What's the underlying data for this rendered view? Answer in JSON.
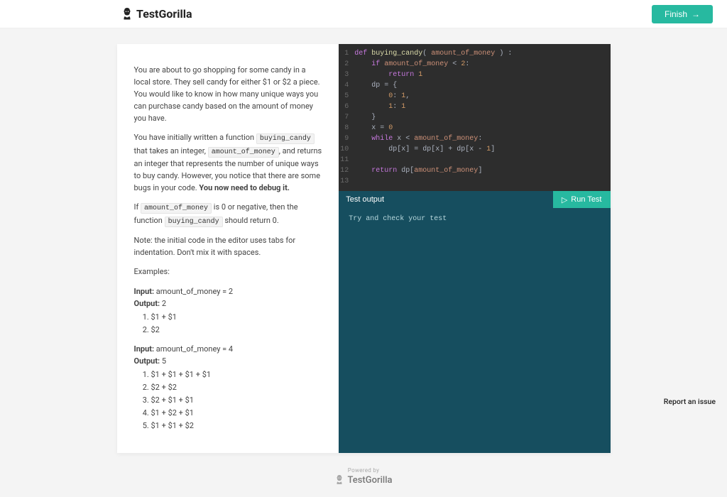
{
  "header": {
    "logo_text": "TestGorilla",
    "finish_label": "Finish"
  },
  "problem": {
    "intro": "You are about to go shopping for some candy in a local store. They sell candy for either $1 or $2 a piece. You would like to know in how many unique ways you can purchase candy based on the amount of money you have.",
    "para2_a": "You have initially written a function ",
    "code_fn": "buying_candy",
    "para2_b": " that takes an integer, ",
    "code_param": "amount_of_money",
    "para2_c": ", and returns an integer that represents the number of unique ways to buy candy. However, you notice that there are some bugs in your code. ",
    "bold_debug": "You now need to debug it.",
    "para3_a": "If ",
    "para3_b": " is 0 or negative, then the function ",
    "para3_c": " should return 0.",
    "note": "Note: the initial code in the editor uses tabs for indentation. Don't mix it with spaces.",
    "examples_label": "Examples:",
    "ex1_input_label": "Input:",
    "ex1_input_val": " amount_of_money = 2",
    "ex1_output_label": "Output:",
    "ex1_output_val": " 2",
    "ex1_items": [
      "$1 + $1",
      "$2"
    ],
    "ex2_input_label": "Input:",
    "ex2_input_val": " amount_of_money = 4",
    "ex2_output_label": "Output:",
    "ex2_output_val": " 5",
    "ex2_items": [
      "$1 + $1 + $1 + $1",
      "$2 + $2",
      "$2 + $1 + $1",
      "$1 + $2 + $1",
      "$1 + $1 + $2"
    ]
  },
  "editor": {
    "lines": [
      {
        "n": "1",
        "tokens": [
          [
            "kw",
            "def "
          ],
          [
            "id",
            "buying_candy"
          ],
          [
            "op",
            "( "
          ],
          [
            "param",
            "amount_of_money"
          ],
          [
            "op",
            " ) :"
          ]
        ]
      },
      {
        "n": "2",
        "tokens": [
          [
            "op",
            "    "
          ],
          [
            "kw",
            "if "
          ],
          [
            "param",
            "amount_of_money"
          ],
          [
            "op",
            " < "
          ],
          [
            "num",
            "2"
          ],
          [
            "op",
            ":"
          ]
        ]
      },
      {
        "n": "3",
        "tokens": [
          [
            "op",
            "        "
          ],
          [
            "kw",
            "return "
          ],
          [
            "num",
            "1"
          ]
        ]
      },
      {
        "n": "4",
        "tokens": [
          [
            "op",
            "    dp = {"
          ]
        ]
      },
      {
        "n": "5",
        "tokens": [
          [
            "op",
            "        "
          ],
          [
            "num",
            "0"
          ],
          [
            "op",
            ": "
          ],
          [
            "num",
            "1"
          ],
          [
            "op",
            ","
          ]
        ]
      },
      {
        "n": "6",
        "tokens": [
          [
            "op",
            "        "
          ],
          [
            "num",
            "1"
          ],
          [
            "op",
            ": "
          ],
          [
            "num",
            "1"
          ]
        ]
      },
      {
        "n": "7",
        "tokens": [
          [
            "op",
            "    }"
          ]
        ]
      },
      {
        "n": "8",
        "tokens": [
          [
            "op",
            "    x = "
          ],
          [
            "num",
            "0"
          ]
        ]
      },
      {
        "n": "9",
        "tokens": [
          [
            "op",
            "    "
          ],
          [
            "kw",
            "while "
          ],
          [
            "op",
            "x < "
          ],
          [
            "param",
            "amount_of_money"
          ],
          [
            "op",
            ":"
          ]
        ]
      },
      {
        "n": "10",
        "tokens": [
          [
            "op",
            "        dp[x] = dp[x] + dp[x - "
          ],
          [
            "num",
            "1"
          ],
          [
            "op",
            "]"
          ]
        ]
      },
      {
        "n": "11",
        "tokens": [
          [
            "op",
            ""
          ]
        ]
      },
      {
        "n": "12",
        "tokens": [
          [
            "op",
            "    "
          ],
          [
            "kw",
            "return "
          ],
          [
            "op",
            "dp["
          ],
          [
            "param",
            "amount_of_money"
          ],
          [
            "op",
            "]"
          ]
        ]
      },
      {
        "n": "13",
        "tokens": [
          [
            "op",
            ""
          ]
        ]
      }
    ]
  },
  "test": {
    "header": "Test output",
    "run_label": "Run Test",
    "output_text": "Try and check your test"
  },
  "footer": {
    "powered_by": "Powered by",
    "brand": "TestGorilla",
    "report": "Report an issue"
  }
}
